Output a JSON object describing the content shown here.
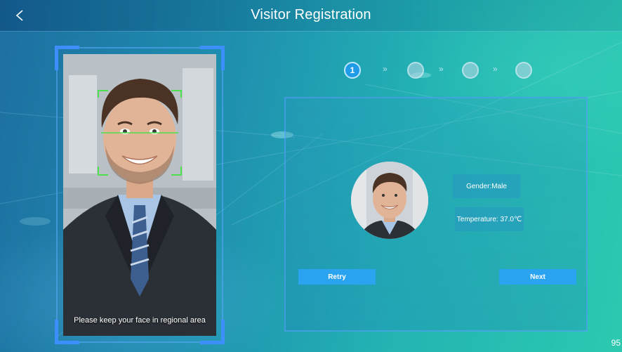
{
  "header": {
    "title": "Visitor Registration",
    "back_icon": "chevron-left-icon"
  },
  "camera": {
    "hint": "Please keep your face in regional area"
  },
  "steps": {
    "items": [
      {
        "label": "1",
        "state": "active"
      },
      {
        "label": "",
        "state": "inactive"
      },
      {
        "label": "",
        "state": "inactive"
      },
      {
        "label": "",
        "state": "inactive"
      }
    ],
    "separator": "»"
  },
  "result": {
    "gender": "Gender:Male",
    "temperature": "Temperature: 37.0℃",
    "retry_label": "Retry",
    "next_label": "Next"
  },
  "footer": {
    "page_number": "95"
  },
  "colors": {
    "accent": "#2aa3f0",
    "frame_corner": "#3d8fff",
    "face_box": "#4ee04e"
  }
}
